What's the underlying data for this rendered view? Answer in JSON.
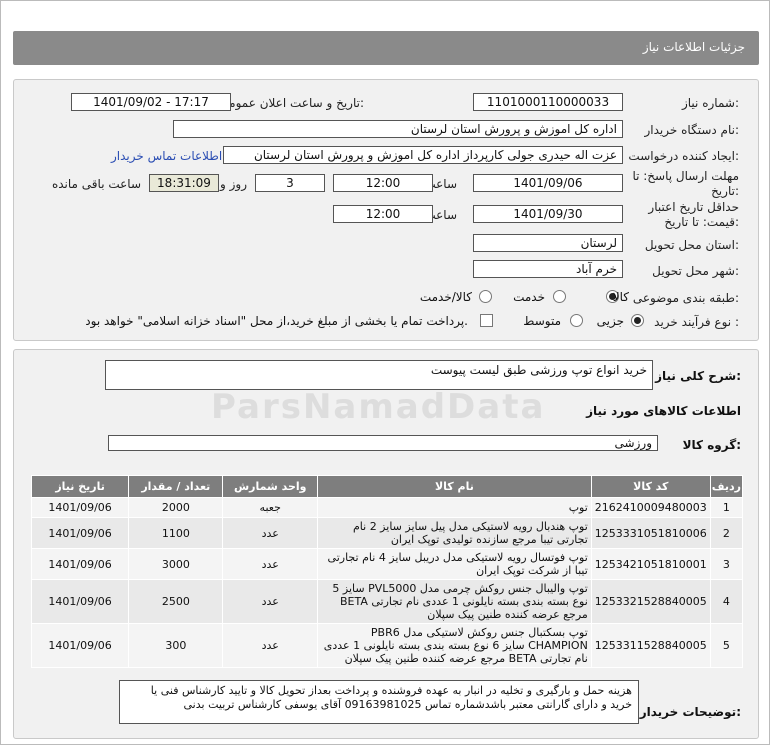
{
  "header": {
    "title": "جزئیات اطلاعات نیاز"
  },
  "form": {
    "need_number_label": "شماره نیاز:",
    "need_number": "1101000110000033",
    "announce_label": "تاریخ و ساعت اعلان عمومی:",
    "announce_value": "1401/09/02 - 17:17",
    "buyer_label": "نام دستگاه خریدار:",
    "buyer_value": "اداره کل اموزش و پرورش استان لرستان",
    "creator_label": "ایجاد کننده درخواست:",
    "creator_value": "عزت اله حیدری جولی کارپرداز اداره کل اموزش و پرورش استان لرستان",
    "contact_link": "اطلاعات تماس خریدار",
    "deadline_label": "مهلت ارسال پاسخ: تا تاریخ:",
    "deadline_date": "1401/09/06",
    "time_label": "ساعت",
    "deadline_time": "12:00",
    "days_value": "3",
    "days_label": "روز و",
    "remaining_time": "18:31:09",
    "remaining_label": "ساعت باقی مانده",
    "validity_label": "حداقل تاریخ اعتبار قیمت: تا تاریخ:",
    "validity_date": "1401/09/30",
    "validity_time_label": "ساعت",
    "validity_time": "12:00",
    "province_label": "استان محل تحویل:",
    "province_value": "لرستان",
    "city_label": "شهر محل تحویل:",
    "city_value": "خرم آباد",
    "category_label": "طبقه بندی موضوعی:",
    "category_options": [
      "کالا",
      "خدمت",
      "کالا/خدمت"
    ],
    "purchase_label": "نوع فرآیند خرید :",
    "purchase_options": [
      "جزیی",
      "متوسط"
    ],
    "payment_note": "پرداخت تمام یا بخشی از مبلغ خرید،از محل \"اسناد خزانه اسلامی\" خواهد بود."
  },
  "summary": {
    "general_label": "شرح کلی نیاز:",
    "general_value": "خرید انواع توپ ورزشی طبق لیست پیوست",
    "goods_info_title": "اطلاعات کالاهای مورد نیاز",
    "group_label": "گروه کالا:",
    "group_value": "ورزشی"
  },
  "table": {
    "headers": [
      "ردیف",
      "کد کالا",
      "نام کالا",
      "واحد شمارش",
      "تعداد / مقدار",
      "تاریخ نیاز"
    ],
    "rows": [
      [
        "1",
        "2162410009480003",
        "توپ",
        "جعبه",
        "2000",
        "1401/09/06"
      ],
      [
        "2",
        "1253331051810006",
        "توپ هندبال رویه لاستیکی مدل پیل سایز سایز 2 نام تجارتی تیبا مرجع سازنده تولیدی توپک ایران",
        "عدد",
        "1100",
        "1401/09/06"
      ],
      [
        "3",
        "1253421051810001",
        "توپ فوتسال رویه لاستیکی مدل دریبل سایز 4 نام تجارتی تیبا از شرکت توپک ایران",
        "عدد",
        "3000",
        "1401/09/06"
      ],
      [
        "4",
        "1253321528840005",
        "توپ والیبال جنس روکش چرمی مدل PVL5000 سایز 5 نوع بسته بندی بسته نایلونی 1 عددی نام تجارتی BETA مرجع عرضه کننده طنین پیک سپلان",
        "عدد",
        "2500",
        "1401/09/06"
      ],
      [
        "5",
        "1253311528840005",
        "توپ بسکتبال جنس روکش لاستیکی مدل PBR6 CHAMPION سایز 6 نوع بسته بندی بسته نایلونی 1 عددی نام تجارتی BETA مرجع عرضه کننده طنین پیک سپلان",
        "عدد",
        "300",
        "1401/09/06"
      ]
    ]
  },
  "notes": {
    "label": "توضیحات خریدار:",
    "text": "هزینه حمل و بارگیری و تخلیه در انبار به عهده فروشنده و پرداخت بعداز تحویل کالا و تایید کارشناس فنی یا خرید و دارای گارانتی معتبر باشدشماره تماس 09163981025 آقای یوسفی کارشناس تربیت بدنی"
  },
  "watermark": "ParsNamadData"
}
